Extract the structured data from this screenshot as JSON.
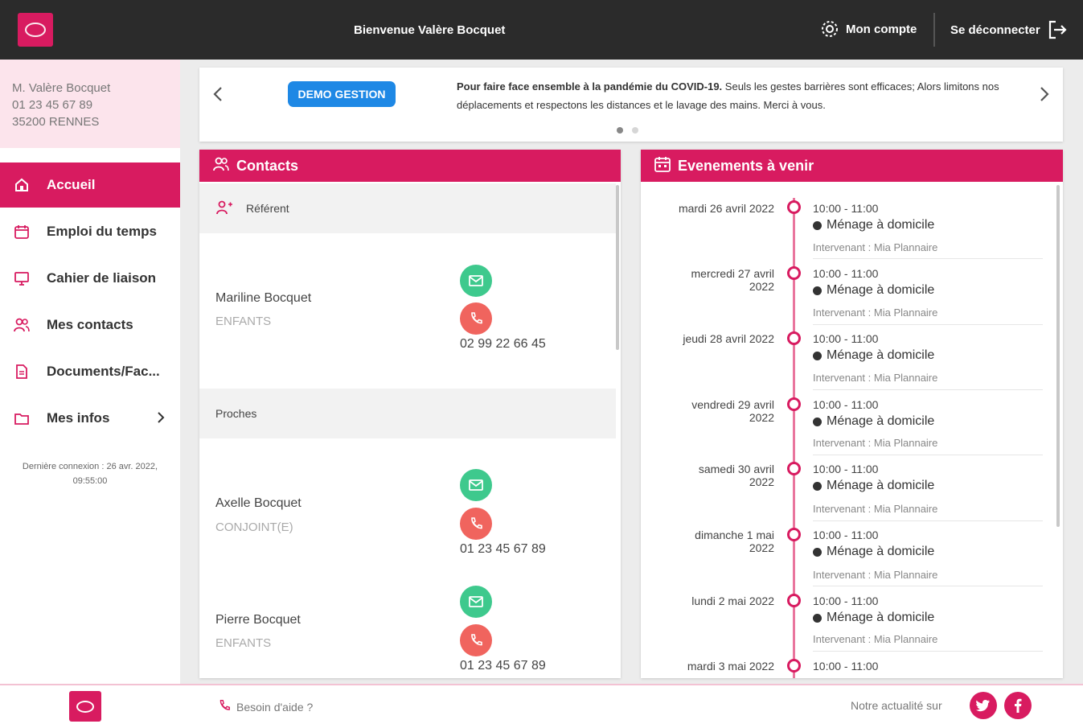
{
  "header": {
    "welcome": "Bienvenue Valère Bocquet",
    "account": "Mon compte",
    "logout": "Se déconnecter"
  },
  "user": {
    "name": "M. Valère Bocquet",
    "phone": "01 23 45 67 89",
    "city": "35200 RENNES"
  },
  "nav": {
    "items": [
      {
        "label": "Accueil",
        "icon": "home-icon"
      },
      {
        "label": "Emploi du temps",
        "icon": "calendar-icon"
      },
      {
        "label": "Cahier de liaison",
        "icon": "monitor-icon"
      },
      {
        "label": "Mes contacts",
        "icon": "users-icon"
      },
      {
        "label": "Documents/Fac...",
        "icon": "document-icon"
      },
      {
        "label": "Mes infos",
        "icon": "folder-icon"
      }
    ],
    "last_connection": "Dernière connexion : 26 avr. 2022, 09:55:00"
  },
  "banner": {
    "badge": "DEMO GESTION",
    "text_bold": "Pour faire face ensemble à la pandémie du COVID-19.",
    "text_rest": "Seuls les gestes barrières sont efficaces; Alors limitons nos déplacements et respectons les distances et le lavage des mains. Merci à vous."
  },
  "contacts": {
    "title": "Contacts",
    "referent_label": "Référent",
    "proches_label": "Proches",
    "people": [
      {
        "name": "Mariline Bocquet",
        "role": "ENFANTS",
        "phone": "02 99 22 66 45"
      },
      {
        "name": "Axelle Bocquet",
        "role": "CONJOINT(E)",
        "phone": "01 23 45 67 89"
      },
      {
        "name": "Pierre Bocquet",
        "role": "ENFANTS",
        "phone": "01 23 45 67 89"
      }
    ]
  },
  "events": {
    "title": "Evenements à venir",
    "items": [
      {
        "date1": "mardi 26 avril 2022",
        "date2": "",
        "time": "10:00 - 11:00",
        "title": "Ménage à domicile",
        "who": "Intervenant : Mia Plannaire"
      },
      {
        "date1": "mercredi 27 avril",
        "date2": "2022",
        "time": "10:00 - 11:00",
        "title": "Ménage à domicile",
        "who": "Intervenant : Mia Plannaire"
      },
      {
        "date1": "jeudi 28 avril 2022",
        "date2": "",
        "time": "10:00 - 11:00",
        "title": "Ménage à domicile",
        "who": "Intervenant : Mia Plannaire"
      },
      {
        "date1": "vendredi 29 avril",
        "date2": "2022",
        "time": "10:00 - 11:00",
        "title": "Ménage à domicile",
        "who": "Intervenant : Mia Plannaire"
      },
      {
        "date1": "samedi 30 avril",
        "date2": "2022",
        "time": "10:00 - 11:00",
        "title": "Ménage à domicile",
        "who": "Intervenant : Mia Plannaire"
      },
      {
        "date1": "dimanche 1 mai",
        "date2": "2022",
        "time": "10:00 - 11:00",
        "title": "Ménage à domicile",
        "who": "Intervenant : Mia Plannaire"
      },
      {
        "date1": "lundi 2 mai 2022",
        "date2": "",
        "time": "10:00 - 11:00",
        "title": "Ménage à domicile",
        "who": "Intervenant : Mia Plannaire"
      },
      {
        "date1": "mardi 3 mai 2022",
        "date2": "",
        "time": "10:00 - 11:00",
        "title": "",
        "who": ""
      }
    ]
  },
  "footer": {
    "help": "Besoin d'aide ?",
    "news": "Notre actualité sur"
  },
  "colors": {
    "brand": "#d81b60",
    "header_bg": "#2b2b2b",
    "badge": "#1e88e5",
    "mail": "#3ec98d",
    "phone": "#f0645e"
  }
}
